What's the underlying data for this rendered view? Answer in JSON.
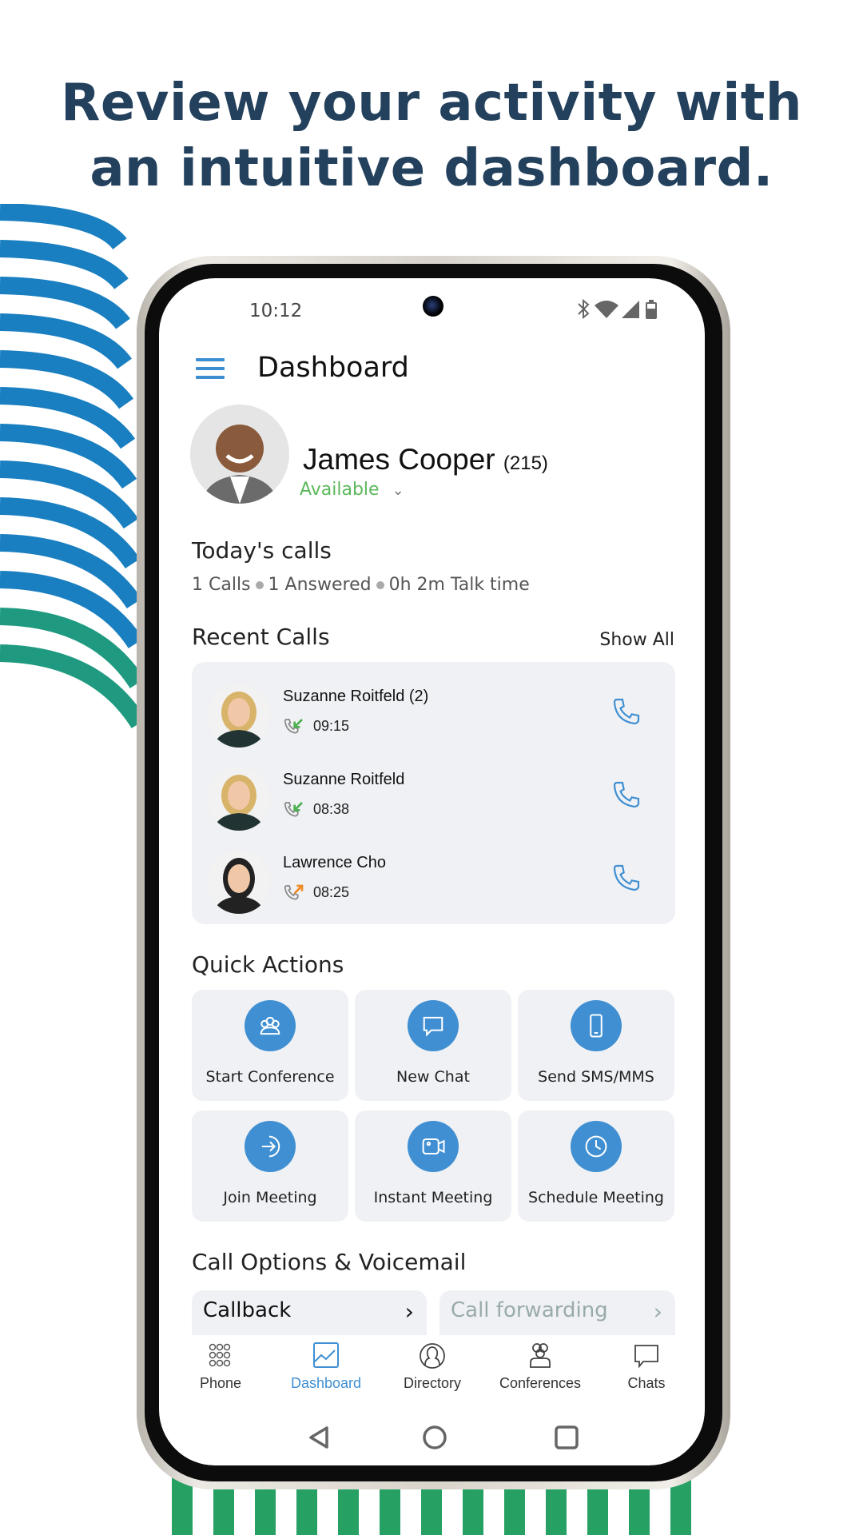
{
  "headline": {
    "line1": "Review your activity with",
    "line2": "an intuitive dashboard."
  },
  "status_bar": {
    "time": "10:12",
    "icons": [
      "bluetooth-icon",
      "wifi-icon",
      "signal-icon",
      "battery-icon"
    ]
  },
  "header": {
    "title": "Dashboard",
    "menu_icon": "hamburger-icon"
  },
  "user": {
    "name": "James Cooper",
    "extension": "(215)",
    "status": "Available",
    "status_color": "#5cb85c"
  },
  "todays_calls": {
    "title": "Today's calls",
    "calls": "1 Calls",
    "answered": "1 Answered",
    "talk_time": "0h 2m Talk time"
  },
  "recent_calls": {
    "title": "Recent Calls",
    "show_all": "Show All",
    "items": [
      {
        "name": "Suzanne Roitfeld (2)",
        "time": "09:15",
        "direction": "incoming"
      },
      {
        "name": "Suzanne Roitfeld",
        "time": "08:38",
        "direction": "incoming"
      },
      {
        "name": "Lawrence Cho",
        "time": "08:25",
        "direction": "outgoing"
      }
    ]
  },
  "quick_actions": {
    "title": "Quick Actions",
    "items": [
      {
        "label": "Start Conference",
        "icon": "conference-icon"
      },
      {
        "label": "New Chat",
        "icon": "chat-icon"
      },
      {
        "label": "Send SMS/MMS",
        "icon": "mobile-icon"
      },
      {
        "label": "Join Meeting",
        "icon": "join-arrow-icon"
      },
      {
        "label": "Instant Meeting",
        "icon": "video-icon"
      },
      {
        "label": "Schedule Meeting",
        "icon": "clock-icon"
      }
    ]
  },
  "call_options": {
    "title": "Call Options & Voicemail",
    "callback": "Callback",
    "call_forwarding": "Call forwarding"
  },
  "bottom_nav": {
    "items": [
      {
        "label": "Phone",
        "icon": "dialpad-icon"
      },
      {
        "label": "Dashboard",
        "icon": "chart-icon",
        "active": true
      },
      {
        "label": "Directory",
        "icon": "person-icon"
      },
      {
        "label": "Conferences",
        "icon": "group-icon"
      },
      {
        "label": "Chats",
        "icon": "chat-bubble-icon"
      }
    ]
  },
  "colors": {
    "accent": "#3f8fd2",
    "headline": "#23405c",
    "stripes_blue": "#1a7fc0",
    "stripes_green": "#27a063",
    "incoming": "#4caf50",
    "outgoing": "#f08a24"
  }
}
